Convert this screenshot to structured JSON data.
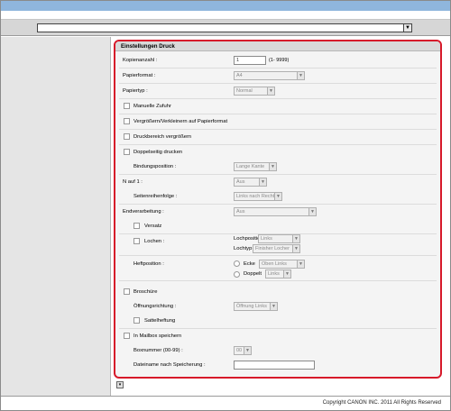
{
  "panel": {
    "title": "Einstellungen Druck"
  },
  "kopienanzahl": {
    "label": "Kopienanzahl :",
    "value": "1",
    "hint": "(1- 9999)"
  },
  "papierformat": {
    "label": "Papierformat :",
    "value": "A4"
  },
  "papiertyp": {
    "label": "Papiertyp :",
    "value": "Normal"
  },
  "manuelle_zufuhr": {
    "label": "Manuelle Zufuhr"
  },
  "vergroessern": {
    "label": "Vergrößern/Verkleinern auf Papierformat"
  },
  "druckbereich": {
    "label": "Druckbereich vergrößern"
  },
  "doppelseitig": {
    "label": "Doppelseitig drucken"
  },
  "bindungsposition": {
    "label": "Bindungsposition :",
    "value": "Lange Kante"
  },
  "n_auf_1": {
    "label": "N auf 1 :",
    "value": "Aus"
  },
  "seitenreihenfolge": {
    "label": "Seitenreihenfolge :",
    "value": "Links nach Rechts"
  },
  "endverarbeitung": {
    "label": "Endverarbeitung :",
    "value": "Aus"
  },
  "versatz": {
    "label": "Versatz"
  },
  "lochen": {
    "label": "Lochen :",
    "lochposition_label": "Lochposition",
    "lochposition_value": "Links",
    "lochtyp_label": "Lochtyp",
    "lochtyp_value": "Finisher Locher"
  },
  "heftposition": {
    "label": "Heftposition :",
    "ecke_label": "Ecke",
    "ecke_value": "Oben Links",
    "doppelt_label": "Doppelt",
    "doppelt_value": "Links"
  },
  "broschuere": {
    "label": "Broschüre"
  },
  "oeffnungsrichtung": {
    "label": "Öffnungsrichtung :",
    "value": "Öffnung Links"
  },
  "sattelheftung": {
    "label": "Sattelheftung"
  },
  "mailbox": {
    "label": "In Mailbox speichern"
  },
  "boxnummer": {
    "label": "Boxnummer (00-99) :",
    "value": "00"
  },
  "dateiname": {
    "label": "Dateiname nach Speicherung :",
    "value": ""
  },
  "footer": {
    "copyright": "Copyright CANON INC. 2011 All Rights Reserved"
  },
  "colors": {
    "accent_border": "#d7192a",
    "title_bar": "#8fb6dd"
  }
}
